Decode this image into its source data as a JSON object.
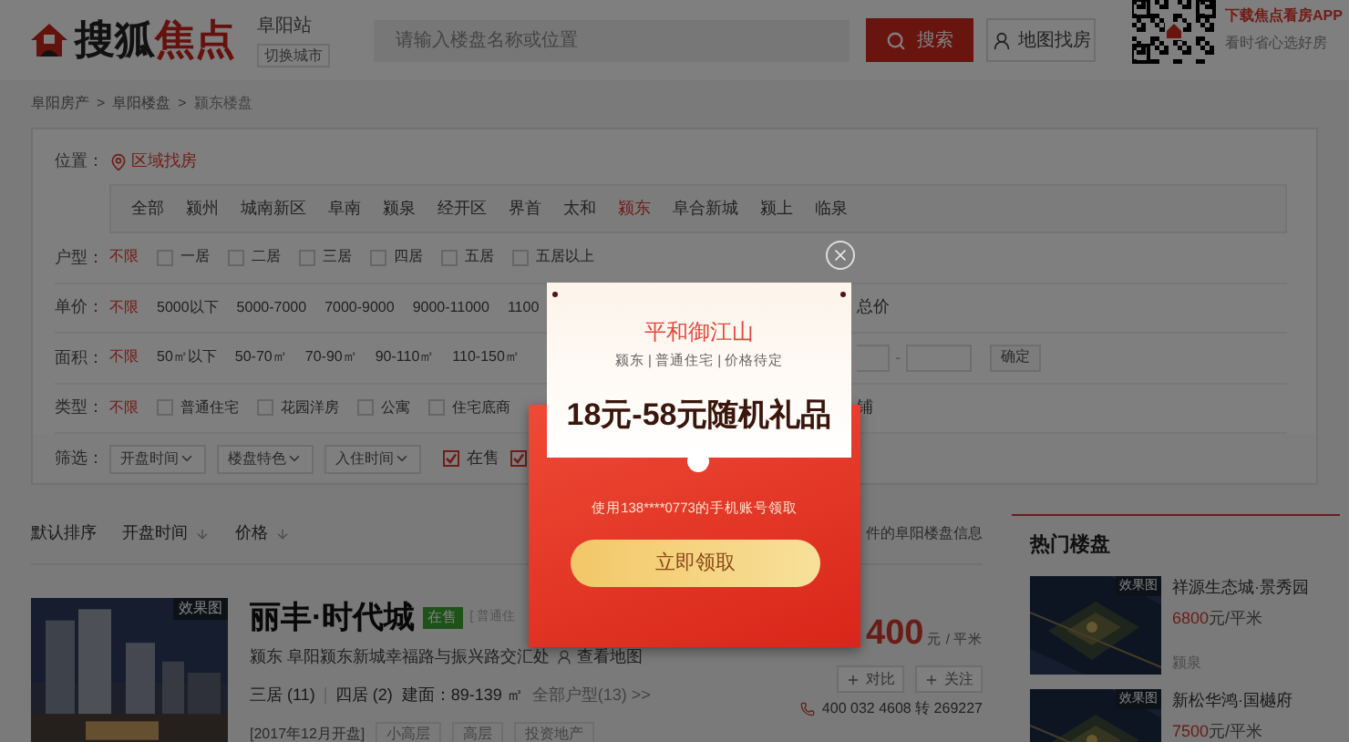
{
  "header": {
    "logo": {
      "text_1": "搜狐",
      "text_2": "焦点"
    },
    "city": "阜阳站",
    "switch_city": "切换城市",
    "search": {
      "placeholder": "请输入楼盘名称或位置",
      "button": "搜索"
    },
    "map_button": "地图找房",
    "app": {
      "title": "下载焦点看房APP",
      "subtitle": "看时省心选好房"
    }
  },
  "breadcrumb": {
    "separator": ">",
    "items": [
      "阜阳房产",
      "阜阳楼盘",
      "颍东楼盘"
    ]
  },
  "filters": {
    "location": {
      "label": "位置：",
      "mode": "区域找房",
      "districts": [
        {
          "label": "全部",
          "selected": false
        },
        {
          "label": "颍州",
          "selected": false
        },
        {
          "label": "城南新区",
          "selected": false
        },
        {
          "label": "阜南",
          "selected": false
        },
        {
          "label": "颍泉",
          "selected": false
        },
        {
          "label": "经开区",
          "selected": false
        },
        {
          "label": "界首",
          "selected": false
        },
        {
          "label": "太和",
          "selected": false
        },
        {
          "label": "颍东",
          "selected": true
        },
        {
          "label": "阜合新城",
          "selected": false
        },
        {
          "label": "颍上",
          "selected": false
        },
        {
          "label": "临泉",
          "selected": false
        }
      ]
    },
    "rows": [
      {
        "label": "户型：",
        "options": [
          {
            "label": "不限",
            "kind": "plain",
            "selected": true
          },
          {
            "label": "一居",
            "kind": "checkbox",
            "selected": false
          },
          {
            "label": "二居",
            "kind": "checkbox",
            "selected": false
          },
          {
            "label": "三居",
            "kind": "checkbox",
            "selected": false
          },
          {
            "label": "四居",
            "kind": "checkbox",
            "selected": false
          },
          {
            "label": "五居",
            "kind": "checkbox",
            "selected": false
          },
          {
            "label": "五居以上",
            "kind": "checkbox",
            "selected": false
          }
        ]
      },
      {
        "label": "单价：",
        "options": [
          {
            "label": "不限",
            "kind": "plain",
            "selected": true
          },
          {
            "label": "5000以下",
            "kind": "plain",
            "selected": false
          },
          {
            "label": "5000-7000",
            "kind": "plain",
            "selected": false
          },
          {
            "label": "7000-9000",
            "kind": "plain",
            "selected": false
          },
          {
            "label": "9000-11000",
            "kind": "plain",
            "selected": false
          },
          {
            "label": "1100",
            "kind": "plain",
            "selected": false
          }
        ],
        "trailing": {
          "kind": "text",
          "text": "总价"
        }
      },
      {
        "label": "面积：",
        "options": [
          {
            "label": "不限",
            "kind": "plain",
            "selected": true
          },
          {
            "label": "50㎡以下",
            "kind": "plain",
            "selected": false
          },
          {
            "label": "50-70㎡",
            "kind": "plain",
            "selected": false
          },
          {
            "label": "70-90㎡",
            "kind": "plain",
            "selected": false
          },
          {
            "label": "90-110㎡",
            "kind": "plain",
            "selected": false
          },
          {
            "label": "110-150㎡",
            "kind": "plain",
            "selected": false
          }
        ],
        "trailing": {
          "kind": "range",
          "separator": "-",
          "button": "确定"
        }
      },
      {
        "label": "类型：",
        "options": [
          {
            "label": "不限",
            "kind": "plain",
            "selected": true
          },
          {
            "label": "普通住宅",
            "kind": "checkbox",
            "selected": false
          },
          {
            "label": "花园洋房",
            "kind": "checkbox",
            "selected": false
          },
          {
            "label": "公寓",
            "kind": "checkbox",
            "selected": false
          },
          {
            "label": "住宅底商",
            "kind": "checkbox",
            "selected": false
          }
        ],
        "trailing": {
          "kind": "text",
          "text": "铺"
        }
      }
    ],
    "screen": {
      "label": "筛选：",
      "dropdowns": [
        "开盘时间",
        "楼盘特色",
        "入住时间"
      ],
      "checks": [
        {
          "label": "在售",
          "checked": true
        },
        {
          "checked": true
        }
      ]
    }
  },
  "sort": {
    "options": [
      {
        "label": "默认排序",
        "kind": "plain"
      },
      {
        "label": "开盘时间",
        "kind": "sortable"
      },
      {
        "label": "价格",
        "kind": "sortable"
      }
    ],
    "summary": "件的阜阳楼盘信息"
  },
  "listing": {
    "image_badge": "效果图",
    "name": "丽丰·时代城",
    "status": "在售",
    "type": "[ 普通住",
    "district": "颍东",
    "address": "阜阳颍东新城幸福路与振兴路交汇处",
    "map_link": "查看地图",
    "layouts": [
      {
        "label": "三居",
        "count": "(11)"
      },
      {
        "label": "四居",
        "count": "(2)"
      }
    ],
    "area": "建面：89-139 ㎡",
    "all_layouts": "全部户型(13) >>",
    "opening": "[2017年12月开盘]",
    "tags": [
      "小高层",
      "高层",
      "投资地产"
    ],
    "price": "400",
    "price_unit": "元 / 平米",
    "actions": [
      "对比",
      "关注"
    ],
    "phone": "400 032 4608 转 269227"
  },
  "hot": {
    "title": "热门楼盘",
    "items": [
      {
        "badge": "效果图",
        "name": "祥源生态城·景秀园",
        "price": "6800",
        "unit": "元/平米",
        "district": "颍泉"
      },
      {
        "badge": "效果图",
        "name": "新松华鸿·国樾府",
        "price": "7500",
        "unit": "元/平米"
      }
    ]
  },
  "popup": {
    "title": "平和御江山",
    "meta": "颍东 | 普通住宅 | 价格待定",
    "gift": "18元-58元随机礼品",
    "account_note": "使用138****0773的手机账号领取",
    "button": "立即领取"
  }
}
